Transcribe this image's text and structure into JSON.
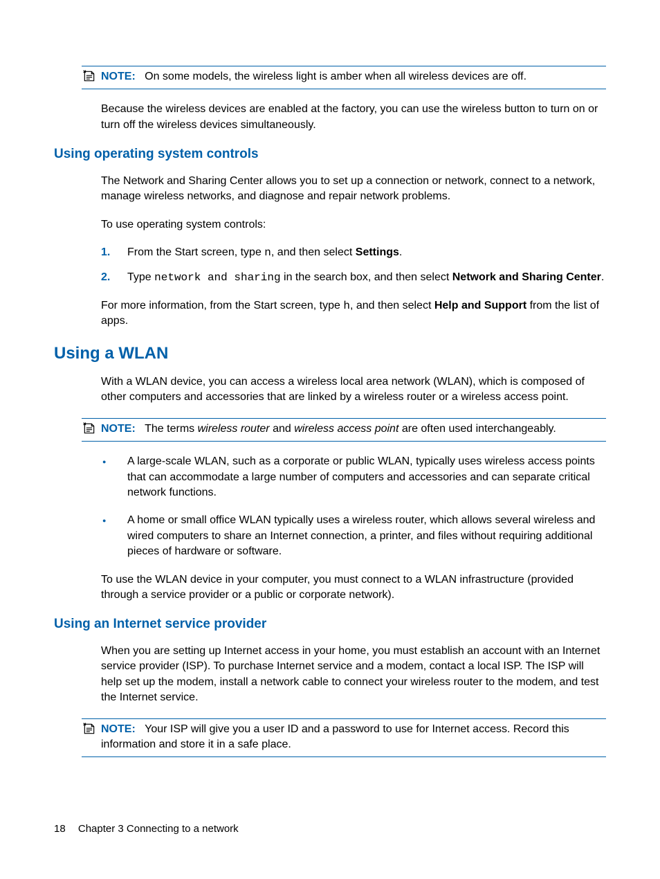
{
  "note1": {
    "label": "NOTE:",
    "text": "On some models, the wireless light is amber when all wireless devices are off."
  },
  "para_factory": "Because the wireless devices are enabled at the factory, you can use the wireless button to turn on or turn off the wireless devices simultaneously.",
  "h3_os": "Using operating system controls",
  "para_netshare": "The Network and Sharing Center allows you to set up a connection or network, connect to a network, manage wireless networks, and diagnose and repair network problems.",
  "para_touse": "To use operating system controls:",
  "step1_a": "From the Start screen, type ",
  "step1_code": "n",
  "step1_b": ", and then select ",
  "step1_bold": "Settings",
  "step1_c": ".",
  "step2_a": "Type ",
  "step2_code": "network and sharing",
  "step2_b": " in the search box, and then select ",
  "step2_bold": "Network and Sharing Center",
  "step2_c": ".",
  "para_moreinfo_a": "For more information, from the Start screen, type ",
  "para_moreinfo_code": "h",
  "para_moreinfo_b": ", and then select ",
  "para_moreinfo_bold": "Help and Support",
  "para_moreinfo_c": " from the list of apps.",
  "h2_wlan": "Using a WLAN",
  "para_wlan": "With a WLAN device, you can access a wireless local area network (WLAN), which is composed of other computers and accessories that are linked by a wireless router or a wireless access point.",
  "note2": {
    "label": "NOTE:",
    "text_a": "The terms ",
    "italic1": "wireless router",
    "text_b": " and ",
    "italic2": "wireless access point",
    "text_c": " are often used interchangeably."
  },
  "bullet1": "A large-scale WLAN, such as a corporate or public WLAN, typically uses wireless access points that can accommodate a large number of computers and accessories and can separate critical network functions.",
  "bullet2": "A home or small office WLAN typically uses a wireless router, which allows several wireless and wired computers to share an Internet connection, a printer, and files without requiring additional pieces of hardware or software.",
  "para_wlaninfra": "To use the WLAN device in your computer, you must connect to a WLAN infrastructure (provided through a service provider or a public or corporate network).",
  "h3_isp": "Using an Internet service provider",
  "para_isp": "When you are setting up Internet access in your home, you must establish an account with an Internet service provider (ISP). To purchase Internet service and a modem, contact a local ISP. The ISP will help set up the modem, install a network cable to connect your wireless router to the modem, and test the Internet service.",
  "note3": {
    "label": "NOTE:",
    "text": "Your ISP will give you a user ID and a password to use for Internet access. Record this information and store it in a safe place."
  },
  "footer": {
    "page": "18",
    "chapter": "Chapter 3   Connecting to a network"
  }
}
